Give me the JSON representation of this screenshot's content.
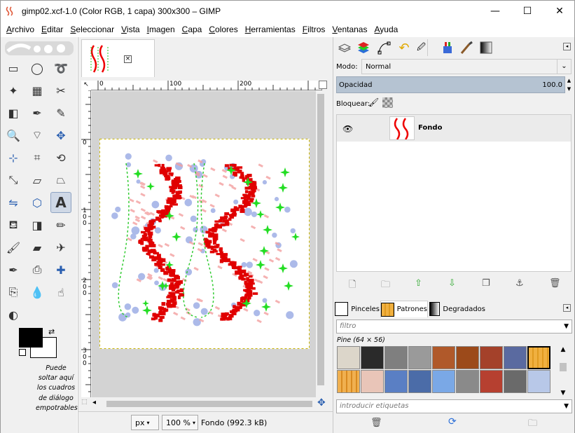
{
  "window": {
    "title": "gimp02.xcf-1.0 (Color RGB, 1 capa) 300x300 – GIMP",
    "minimize": "—",
    "maximize": "☐",
    "close": "✕"
  },
  "menu": [
    "Archivo",
    "Editar",
    "Seleccionar",
    "Vista",
    "Imagen",
    "Capa",
    "Colores",
    "Herramientas",
    "Filtros",
    "Ventanas",
    "Ayuda"
  ],
  "toolbox": {
    "drop_note": "Puede soltar aquí los cuadros de diálogo empotrables",
    "fg_color": "#000000",
    "bg_color": "#ffffff",
    "tools": [
      "rect-select-icon",
      "ellipse-select-icon",
      "lasso-icon",
      "fuzzy-select-icon",
      "color-select-icon",
      "scissors-icon",
      "foreground-select-icon",
      "paths-icon",
      "color-picker-icon",
      "zoom-icon",
      "measure-icon",
      "move-icon",
      "align-icon",
      "crop-icon",
      "rotate-icon",
      "scale-icon",
      "shear-icon",
      "perspective-icon",
      "flip-icon",
      "cage-icon",
      "text-icon",
      "bucket-fill-icon",
      "gradient-icon",
      "pencil-icon",
      "paintbrush-icon",
      "eraser-icon",
      "airbrush-icon",
      "ink-icon",
      "clone-icon",
      "heal-icon",
      "perspective-clone-icon",
      "blur-icon",
      "smudge-icon",
      "dodge-burn-icon"
    ]
  },
  "image_window": {
    "ruler_h": [
      "0",
      "100",
      "200"
    ],
    "ruler_v": [
      "0",
      "100",
      "200",
      "300"
    ],
    "unit": "px",
    "zoom": "100 %",
    "status": "Fondo (992.3 kB)"
  },
  "layers_dock": {
    "mode_label": "Modo:",
    "mode_value": "Normal",
    "opacity_label": "Opacidad",
    "opacity_value": "100.0",
    "lock_label": "Bloquear:",
    "layer_name": "Fondo"
  },
  "patterns_dock": {
    "tabs": [
      "Pinceles",
      "Patrones",
      "Degradados"
    ],
    "filter_placeholder": "filtro",
    "selected_pattern": "Pine (64 × 56)",
    "tags_placeholder": "introducir etiquetas",
    "patterns": [
      "#dcd6ca",
      "#2a2a2a",
      "#7f7f7f",
      "#9a9a9a",
      "#b0592a",
      "#9c4a1a",
      "#a4412a",
      "#5a6aa0",
      "#e9b24a",
      "#e7a24a",
      "#e9c5b8",
      "#5a7fc4",
      "#4b6ca8",
      "#7aa8e6",
      "#8a8a8a",
      "#b64030",
      "#6a6a6a",
      "#b8c8e8"
    ]
  }
}
